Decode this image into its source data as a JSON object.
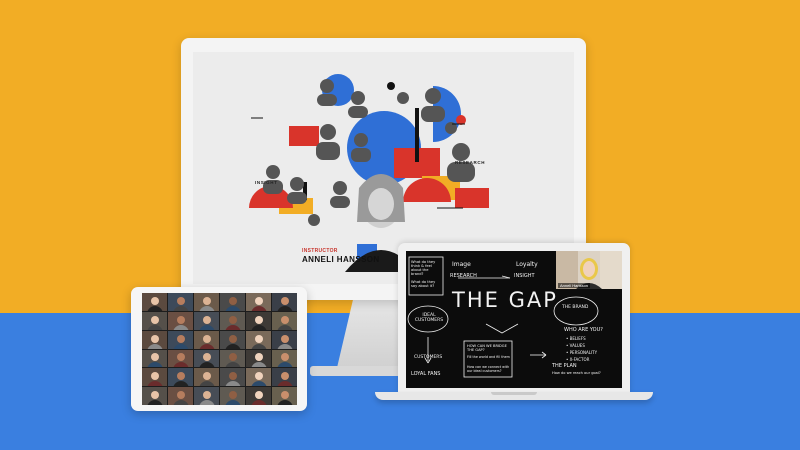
{
  "colors": {
    "background_top": "#f2ad25",
    "background_bottom": "#3a7fe0",
    "accent_red": "#d9342b",
    "accent_blue": "#2f6fd6",
    "accent_yellow": "#f2ad25",
    "blackboard": "#0c0c0c"
  },
  "imac": {
    "speaker_tag": "INSTRUCTOR",
    "speaker_name": "ANNELI HANSSON",
    "collage_labels": {
      "research": "RESEARCH",
      "insight": "INSIGHT",
      "identity": "IDENTITY",
      "marketing": "MARKETING"
    }
  },
  "tablet": {
    "participant_tiles": 36
  },
  "laptop": {
    "webcam_name": "Anneli Hansson",
    "board": {
      "title": "THE GAP",
      "image": "Image",
      "loyalty": "Loyalty",
      "research": "RESEARCH",
      "insight": "INSIGHT",
      "ideal_customers": "IDEAL CUSTOMERS",
      "the_brand": "THE BRAND",
      "who_are_you": "WHO ARE YOU?",
      "beliefs": "• BELIEFS",
      "values": "• VALUES",
      "personality": "• PERSONALITY",
      "y_factor": "• X-FACTOR",
      "customers": "CUSTOMERS",
      "loyal_fans": "LOYAL FANS",
      "bridge_question": "HOW CAN WE BRIDGE THE GAP?",
      "fill_world": "Fill the world and fill them",
      "how_connect": "How can we connect with our ideal customers?",
      "the_plan": "THE PLAN",
      "how_reach": "How do we reach our goal?",
      "what_do_they": "What do they think & feel about the brand?",
      "what_say": "What do they say about it?"
    }
  }
}
